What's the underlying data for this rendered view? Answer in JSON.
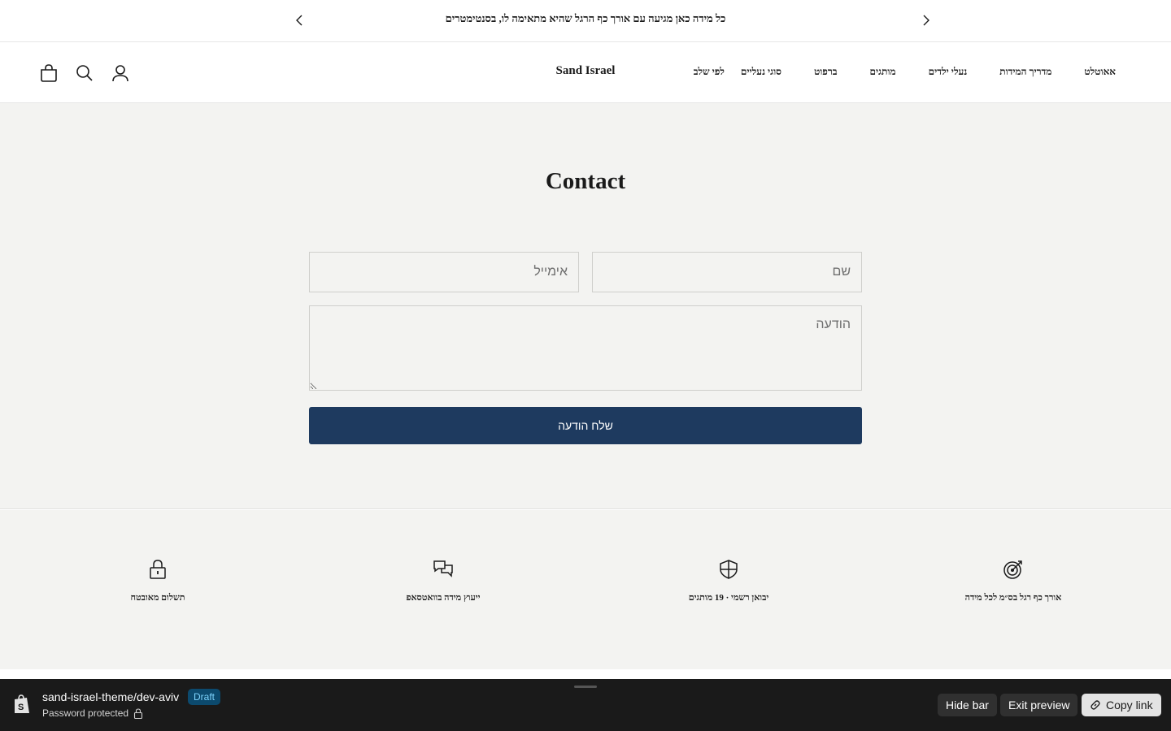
{
  "announcement": {
    "text": "כל מידה כאן מגיעה עם אורך כף הרגל שהיא מתאימה לו, בסנטימטרים"
  },
  "header": {
    "logo": "Sand Israel",
    "nav": [
      "לפי שלב",
      "סוגי נעליים",
      "ברפוט",
      "מותגים",
      "נעלי ילדים",
      "מדריך המידות",
      "אאוטלט"
    ]
  },
  "contact": {
    "title": "Contact",
    "name_placeholder": "שם",
    "email_placeholder": "אימייל",
    "message_placeholder": "הודעה",
    "submit_label": "שלח הודעה"
  },
  "features": [
    {
      "label": "אורך כף רגל בס״מ לכל מידה",
      "icon": "target-icon"
    },
    {
      "label": "יבואן רשמי · 19 מותגים",
      "icon": "shield-icon"
    },
    {
      "label": "ייעוץ מידה בוואטסאפ",
      "icon": "chat-icon"
    },
    {
      "label": "תשלום מאובטח",
      "icon": "lock-icon"
    }
  ],
  "preview_bar": {
    "theme_name": "sand-israel-theme/dev-aviv",
    "status_badge": "Draft",
    "password_text": "Password protected",
    "hide_bar": "Hide bar",
    "exit_preview": "Exit preview",
    "copy_link": "Copy link"
  }
}
